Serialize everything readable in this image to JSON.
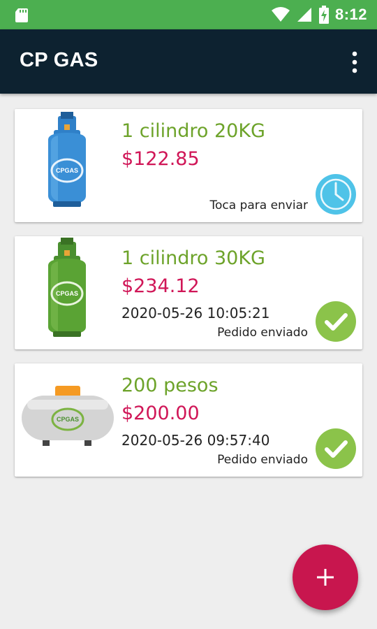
{
  "status_bar": {
    "time": "8:12",
    "icons": [
      "sd-card-icon",
      "wifi-icon",
      "signal-icon",
      "battery-charging-icon"
    ]
  },
  "app_bar": {
    "title": "CP GAS",
    "menu_icon": "more-vert-icon"
  },
  "orders": [
    {
      "name": "1 cilindro 20KG",
      "price": "$122.85",
      "timestamp": "",
      "status": "Toca para enviar",
      "status_icon": "clock-icon",
      "illustration": "blue-cylinder-icon"
    },
    {
      "name": "1 cilindro 30KG",
      "price": "$234.12",
      "timestamp": "2020-05-26 10:05:21",
      "status": "Pedido enviado",
      "status_icon": "check-circle-icon",
      "illustration": "green-cylinder-icon"
    },
    {
      "name": "200 pesos",
      "price": "$200.00",
      "timestamp": "2020-05-26 09:57:40",
      "status": "Pedido enviado",
      "status_icon": "check-circle-icon",
      "illustration": "stationary-tank-icon"
    }
  ],
  "fab": {
    "icon": "plus-icon"
  },
  "colors": {
    "status_bar": "#4caf50",
    "app_bar": "#0d2230",
    "product_name": "#6da32a",
    "price": "#d01657",
    "check": "#8bc34a",
    "clock": "#4fc3e8",
    "fab": "#c8164e"
  }
}
